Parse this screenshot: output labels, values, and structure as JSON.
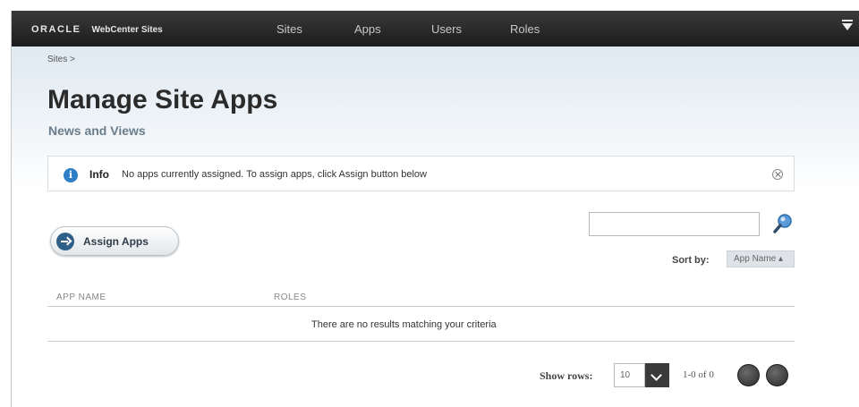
{
  "header": {
    "brand_oracle": "ORACLE",
    "brand_product": "WebCenter Sites",
    "nav": [
      "Sites",
      "Apps",
      "Users",
      "Roles"
    ]
  },
  "breadcrumb": "Sites >",
  "title": "Manage Site Apps",
  "subtitle": "News and Views",
  "info": {
    "label": "Info",
    "message": "No apps currently assigned. To assign apps, click Assign button below"
  },
  "assign_button": "Assign Apps",
  "search": {
    "value": ""
  },
  "sort": {
    "label": "Sort by:",
    "value": "App Name ▴"
  },
  "table": {
    "columns": [
      "APP NAME",
      "ROLES"
    ],
    "empty_message": "There are no results matching your criteria"
  },
  "pagination": {
    "show_rows_label": "Show rows:",
    "rows_value": "10",
    "count": "1-0 of 0"
  },
  "colors": {
    "topbar": "#1c1c1c",
    "info_icon": "#2f7fc8",
    "assign_icon": "#2d5f88"
  }
}
